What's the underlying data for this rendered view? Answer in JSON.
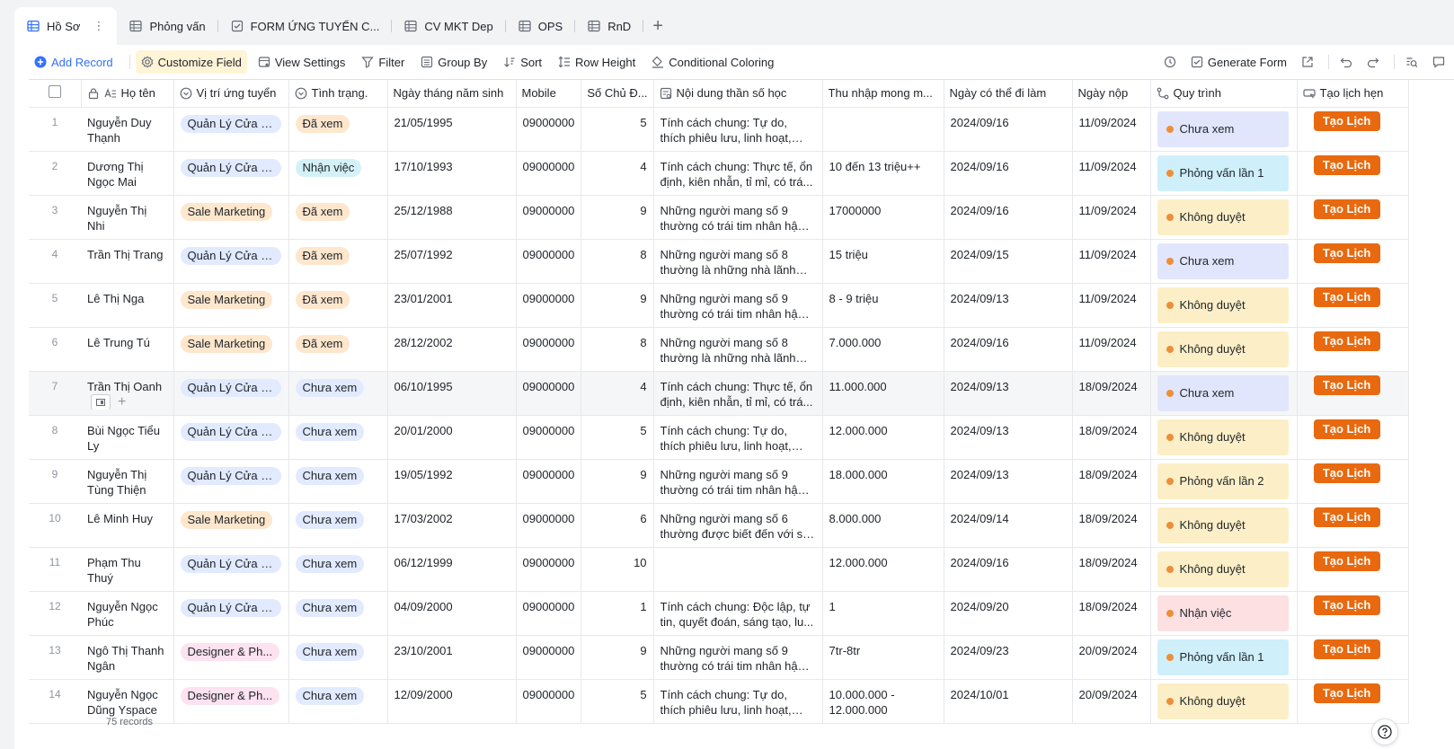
{
  "tabs": [
    {
      "label": "Hồ Sơ",
      "active": true
    },
    {
      "label": "Phỏng vấn"
    },
    {
      "label": "FORM ỨNG TUYỂN C..."
    },
    {
      "label": "CV MKT Dep"
    },
    {
      "label": "OPS"
    },
    {
      "label": "RnD"
    }
  ],
  "toolbar": {
    "add_record": "Add Record",
    "customize_field": "Customize Field",
    "view_settings": "View Settings",
    "filter": "Filter",
    "group_by": "Group By",
    "sort": "Sort",
    "row_height": "Row Height",
    "conditional_coloring": "Conditional Coloring",
    "generate_form": "Generate Form"
  },
  "columns": [
    "Họ tên",
    "Vị trí ứng tuyển",
    "Tình trạng.",
    "Ngày tháng năm sinh",
    "Mobile",
    "Số Chủ Đ...",
    "Nội dung thần số học",
    "Thu nhập mong m...",
    "Ngày có thể đi làm",
    "Ngày nộp",
    "Quy trình",
    "Tạo lịch hẹn"
  ],
  "rows": [
    {
      "n": "1",
      "name": "Nguyễn Duy Thạnh",
      "pos": "Quản Lý Cửa H...",
      "pc": "blue",
      "status": "Đã xem",
      "sc": "orange",
      "dob": "21/05/1995",
      "mobile": "09000000",
      "so": "5",
      "nd": "Tính cách chung: Tự do, thích phiêu lưu, linh hoạt, thích th...",
      "thu": "",
      "start": "2024/09/16",
      "nop": "11/09/2024",
      "qt": "Chưa xem",
      "qc": "blue",
      "btn": "Tạo Lịch"
    },
    {
      "n": "2",
      "name": "Dương Thị Ngọc Mai",
      "pos": "Quản Lý Cửa H...",
      "pc": "blue",
      "status": "Nhận việc",
      "sc": "cyan",
      "dob": "17/10/1993",
      "mobile": "09000000",
      "so": "4",
      "nd": "Tính cách chung: Thực tế, ổn định, kiên nhẫn, tỉ mỉ, có trá...",
      "thu": "10 đến 13 triệu++",
      "start": "2024/09/16",
      "nop": "11/09/2024",
      "qt": "Phỏng vấn lần 1",
      "qc": "cyan",
      "btn": "Tạo Lịch"
    },
    {
      "n": "3",
      "name": "Nguyễn Thị  Nhi",
      "pos": "Sale Marketing",
      "pc": "orange",
      "status": "Đã xem",
      "sc": "orange",
      "dob": "25/12/1988",
      "mobile": "09000000",
      "so": "9",
      "nd": "Những người mang số 9 thường có trái tim nhân hậu và t...",
      "thu": "17000000",
      "start": "2024/09/16",
      "nop": "11/09/2024",
      "qt": "Không duyệt",
      "qc": "yellow",
      "btn": "Tạo Lịch"
    },
    {
      "n": "4",
      "name": "Trần Thị Trang",
      "pos": "Quản Lý Cửa H...",
      "pc": "blue",
      "status": "Đã xem",
      "sc": "orange",
      "dob": "25/07/1992",
      "mobile": "09000000",
      "so": "8",
      "nd": "Những người mang số 8 thường là những nhà lãnh đạo tà...",
      "thu": "15 triệu",
      "start": "2024/09/15",
      "nop": "11/09/2024",
      "qt": "Chưa xem",
      "qc": "blue",
      "btn": "Tạo Lịch"
    },
    {
      "n": "5",
      "name": "Lê Thị Nga",
      "pos": "Sale Marketing",
      "pc": "orange",
      "status": "Đã xem",
      "sc": "orange",
      "dob": "23/01/2001",
      "mobile": "09000000",
      "so": "9",
      "nd": "Những người mang số 9 thường có trái tim nhân hậu và t...",
      "thu": "8 - 9 triệu",
      "start": "2024/09/13",
      "nop": "11/09/2024",
      "qt": "Không duyệt",
      "qc": "yellow",
      "btn": "Tạo Lịch"
    },
    {
      "n": "6",
      "name": "Lê Trung Tú",
      "pos": "Sale Marketing",
      "pc": "orange",
      "status": "Đã xem",
      "sc": "orange",
      "dob": "28/12/2002",
      "mobile": "09000000",
      "so": "8",
      "nd": "Những người mang số 8 thường là những nhà lãnh đạo tà...",
      "thu": "7.000.000",
      "start": "2024/09/16",
      "nop": "11/09/2024",
      "qt": "Không duyệt",
      "qc": "yellow",
      "btn": "Tạo Lịch"
    },
    {
      "n": "7",
      "name": "Trần Thị Oanh",
      "pos": "Quản Lý Cửa H...",
      "pc": "blue",
      "status": "Chưa xem",
      "sc": "gray",
      "dob": "06/10/1995",
      "mobile": "09000000",
      "so": "4",
      "nd": "Tính cách chung: Thực tế, ổn định, kiên nhẫn, tỉ mỉ, có trá...",
      "thu": "11.000.000",
      "start": "2024/09/13",
      "nop": "18/09/2024",
      "qt": "Chưa xem",
      "qc": "blue",
      "btn": "Tạo Lịch"
    },
    {
      "n": "8",
      "name": "Bùi Ngọc Tiểu Ly",
      "pos": "Quản Lý Cửa H...",
      "pc": "blue",
      "status": "Chưa xem",
      "sc": "gray",
      "dob": "20/01/2000",
      "mobile": "09000000",
      "so": "5",
      "nd": "Tính cách chung: Tự do, thích phiêu lưu, linh hoạt, thích th...",
      "thu": "12.000.000",
      "start": "2024/09/13",
      "nop": "18/09/2024",
      "qt": "Không duyệt",
      "qc": "yellow",
      "btn": "Tạo Lịch"
    },
    {
      "n": "9",
      "name": "Nguyễn Thị Tùng Thiện",
      "pos": "Quản Lý Cửa H...",
      "pc": "blue",
      "status": "Chưa xem",
      "sc": "gray",
      "dob": "19/05/1992",
      "mobile": "09000000",
      "so": "9",
      "nd": "Những người mang số 9 thường có trái tim nhân hậu và t...",
      "thu": "18.000.000",
      "start": "2024/09/13",
      "nop": "18/09/2024",
      "qt": "Phỏng vấn lần 2",
      "qc": "yellow",
      "btn": "Tạo Lịch"
    },
    {
      "n": "10",
      "name": "Lê Minh Huy",
      "pos": "Sale Marketing",
      "pc": "orange",
      "status": "Chưa xem",
      "sc": "gray",
      "dob": "17/03/2002",
      "mobile": "09000000",
      "so": "6",
      "nd": "Những người mang số 6 thường được biết đến với sự ấm...",
      "thu": "8.000.000",
      "start": "2024/09/14",
      "nop": "18/09/2024",
      "qt": "Không duyệt",
      "qc": "yellow",
      "btn": "Tạo Lịch"
    },
    {
      "n": "11",
      "name": "Phạm Thu Thuý",
      "pos": "Quản Lý Cửa H...",
      "pc": "blue",
      "status": "Chưa xem",
      "sc": "gray",
      "dob": "06/12/1999",
      "mobile": "09000000",
      "so": "10",
      "nd": "",
      "thu": "12.000.000",
      "start": "2024/09/16",
      "nop": "18/09/2024",
      "qt": "Không duyệt",
      "qc": "yellow",
      "btn": "Tạo Lịch"
    },
    {
      "n": "12",
      "name": "Nguyễn Ngọc Phúc",
      "pos": "Quản Lý Cửa H...",
      "pc": "blue",
      "status": "Chưa xem",
      "sc": "gray",
      "dob": "04/09/2000",
      "mobile": "09000000",
      "so": "1",
      "nd": "Tính cách chung: Độc lập, tự tin, quyết đoán, sáng tạo, lu...",
      "thu": "1",
      "start": "2024/09/20",
      "nop": "18/09/2024",
      "qt": "Nhận việc",
      "qc": "pink",
      "btn": "Tạo Lịch"
    },
    {
      "n": "13",
      "name": "Ngô Thị Thanh Ngân",
      "pos": "Designer & Ph...",
      "pc": "pink",
      "status": "Chưa xem",
      "sc": "gray",
      "dob": "23/10/2001",
      "mobile": "09000000",
      "so": "9",
      "nd": "Những người mang số 9 thường có trái tim nhân hậu và t...",
      "thu": "7tr-8tr",
      "start": "2024/09/23",
      "nop": "20/09/2024",
      "qt": "Phỏng vấn lần 1",
      "qc": "cyan",
      "btn": "Tạo Lịch"
    },
    {
      "n": "14",
      "name": "Nguyễn Ngọc Dũng Yspace",
      "pos": "Designer & Ph...",
      "pc": "pink",
      "status": "Chưa xem",
      "sc": "gray",
      "dob": "12/09/2000",
      "mobile": "09000000",
      "so": "5",
      "nd": "Tính cách chung: Tự do, thích phiêu lưu, linh hoạt, thích th...",
      "thu": "10.000.000 - 12.000.000",
      "start": "2024/10/01",
      "nop": "20/09/2024",
      "qt": "Không duyệt",
      "qc": "yellow",
      "btn": "Tạo Lịch"
    }
  ],
  "footer": {
    "records": "75 records"
  },
  "colors": {
    "accent": "#3370ff",
    "button": "#e8690f",
    "dot": "#ed8f3a"
  }
}
